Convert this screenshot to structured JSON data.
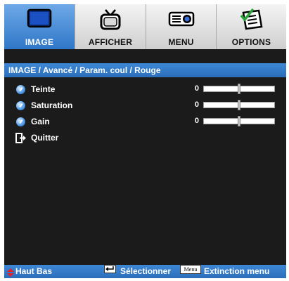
{
  "tabs": [
    {
      "label": "IMAGE",
      "icon": "monitor-icon",
      "active": true
    },
    {
      "label": "AFFICHER",
      "icon": "tv-icon",
      "active": false
    },
    {
      "label": "MENU",
      "icon": "projector-icon",
      "active": false
    },
    {
      "label": "OPTIONS",
      "icon": "checklist-icon",
      "active": false
    }
  ],
  "breadcrumb": "IMAGE / Avancé / Param. coul / Rouge",
  "items": [
    {
      "label": "Teinte",
      "value": "0",
      "level": 0.5
    },
    {
      "label": "Saturation",
      "value": "0",
      "level": 0.5
    },
    {
      "label": "Gain",
      "value": "0",
      "level": 0.5
    }
  ],
  "exit": {
    "label": "Quitter"
  },
  "footer": {
    "nav": "Haut Bas",
    "select": "Sélectionner",
    "menu_key": "Menu",
    "exit_menu": "Extinction menu"
  },
  "colors": {
    "accent": "#2f77c8",
    "background": "#1b1b1b",
    "text": "#ffffff",
    "arrow": "#e8202a"
  }
}
